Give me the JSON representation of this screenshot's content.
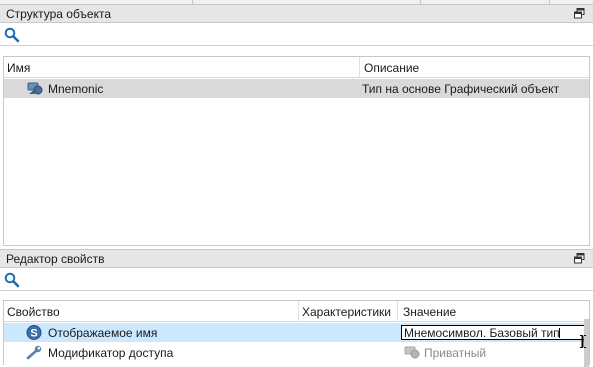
{
  "structure_panel": {
    "title": "Структура объекта",
    "search": {
      "value": "",
      "placeholder": ""
    },
    "columns": {
      "name": "Имя",
      "description": "Описание"
    },
    "rows": [
      {
        "name": "Mnemonic",
        "description": "Тип на основе Графический объект",
        "icon": "graphic-object-icon",
        "selected": true
      }
    ]
  },
  "properties_panel": {
    "title": "Редактор свойств",
    "search": {
      "value": "",
      "placeholder": ""
    },
    "columns": {
      "property": "Свойство",
      "characteristics": "Характеристики",
      "value": "Значение"
    },
    "rows": [
      {
        "property": "Отображаемое имя",
        "value": "Мнемосимвол. Базовый тип",
        "icon": "s-badge-icon",
        "selected": true,
        "editing": true
      },
      {
        "property": "Модификатор доступа",
        "value": "Приватный",
        "icon": "wrench-icon",
        "value_icon": "private-graphic-icon",
        "selected": false
      }
    ]
  },
  "colors": {
    "selection_gray": "#d9d9d9",
    "selection_blue": "#cce8ff",
    "panel_header": "#e6e6e6",
    "search_icon": "#1e6fb5"
  }
}
